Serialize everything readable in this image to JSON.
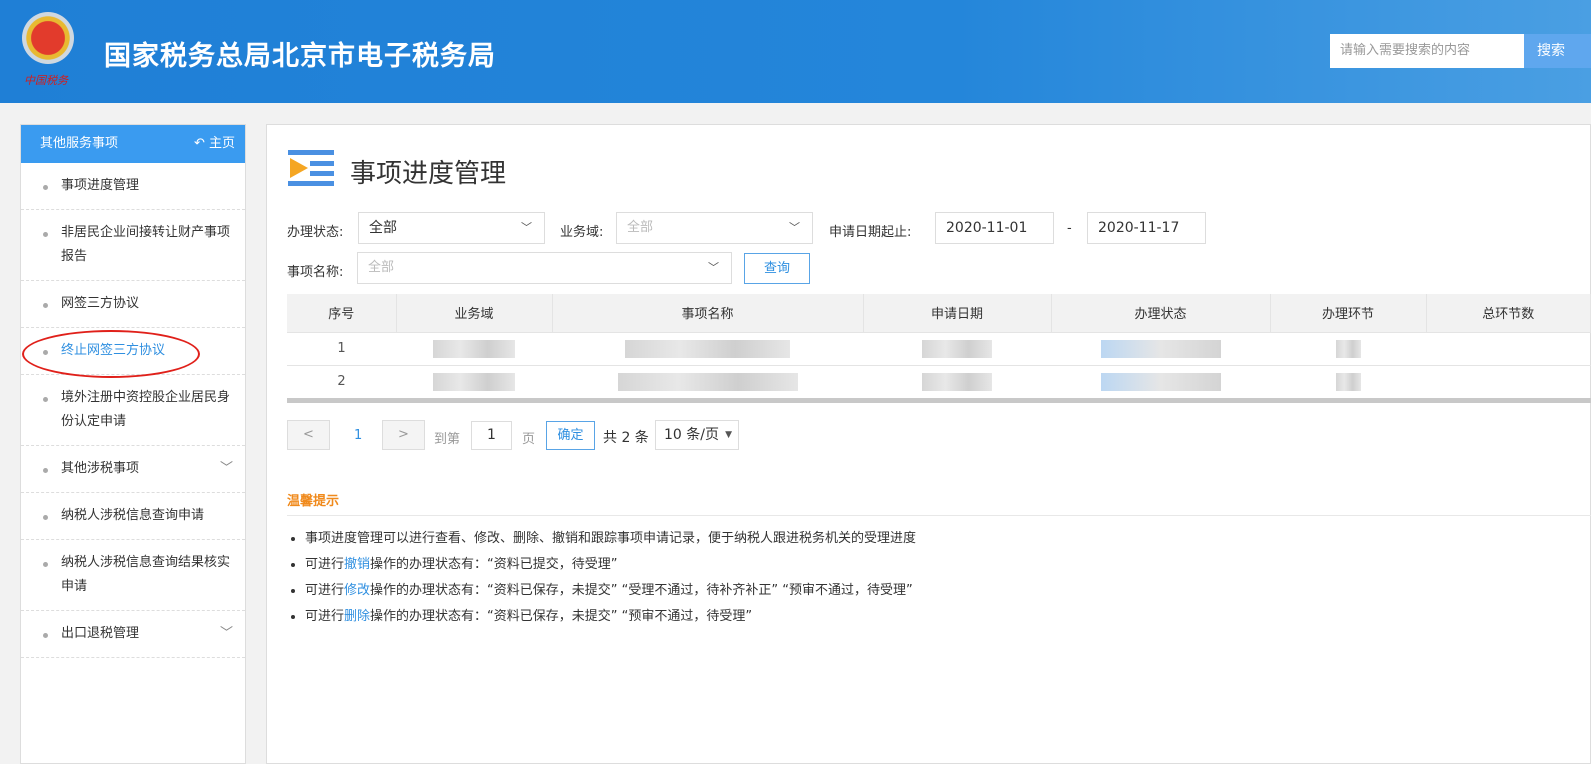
{
  "header": {
    "title": "国家税务总局北京市电子税务局",
    "seal_text": "中国税务",
    "search_placeholder": "请输入需要搜索的内容",
    "search_button": "搜索"
  },
  "sidebar": {
    "heading": "其他服务事项",
    "home": "主页",
    "items": [
      {
        "label": "事项进度管理"
      },
      {
        "label": "非居民企业间接转让财产事项报告"
      },
      {
        "label": "网签三方协议"
      },
      {
        "label": "终止网签三方协议"
      },
      {
        "label": "境外注册中资控股企业居民身份认定申请"
      },
      {
        "label": "其他涉税事项"
      },
      {
        "label": "纳税人涉税信息查询申请"
      },
      {
        "label": "纳税人涉税信息查询结果核实申请"
      },
      {
        "label": "出口退税管理"
      }
    ]
  },
  "main": {
    "title": "事项进度管理",
    "filters": {
      "status_label": "办理状态:",
      "status_value": "全部",
      "domain_label": "业务域:",
      "domain_value": "全部",
      "date_label": "申请日期起止:",
      "date_from": "2020-11-01",
      "date_sep": "-",
      "date_to": "2020-11-17",
      "name_label": "事项名称:",
      "name_value": "全部",
      "query_button": "查询"
    },
    "table": {
      "columns": [
        "序号",
        "业务域",
        "事项名称",
        "申请日期",
        "办理状态",
        "办理环节",
        "总环节数"
      ],
      "rows": [
        {
          "index": "1"
        },
        {
          "index": "2"
        }
      ]
    },
    "pagination": {
      "page": "1",
      "goto_label": "到第",
      "goto_value": "1",
      "page_unit": "页",
      "confirm": "确定",
      "total": "共 2 条",
      "per_page": "10 条/页"
    },
    "tips": {
      "title": "温馨提示",
      "items": [
        {
          "pre": "事项进度管理可以进行查看、修改、删除、撤销和跟踪事项申请记录，便于纳税人跟进税务机关的受理进度",
          "link": "",
          "post": ""
        },
        {
          "pre": "可进行",
          "link": "撤销",
          "post": "操作的办理状态有：“资料已提交，待受理”"
        },
        {
          "pre": "可进行",
          "link": "修改",
          "post": "操作的办理状态有：“资料已保存，未提交”  “受理不通过，待补齐补正”  “预审不通过，待受理”"
        },
        {
          "pre": "可进行",
          "link": "删除",
          "post": "操作的办理状态有：“资料已保存，未提交”  “预审不通过，待受理”"
        }
      ]
    }
  }
}
